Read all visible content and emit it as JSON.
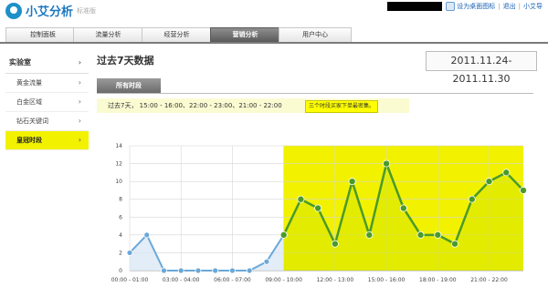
{
  "header": {
    "logo_text": "小艾分析",
    "logo_sub": "标准版",
    "links": [
      "设为桌面图标",
      "退出",
      "小艾导"
    ]
  },
  "nav": {
    "tabs": [
      {
        "label": "控制面板",
        "active": false
      },
      {
        "label": "流量分析",
        "active": false
      },
      {
        "label": "经营分析",
        "active": false
      },
      {
        "label": "营销分析",
        "active": true
      },
      {
        "label": "用户中心",
        "active": false
      }
    ]
  },
  "sidebar": {
    "heading": "实验室",
    "items": [
      {
        "label": "黄金流量",
        "active": false
      },
      {
        "label": "白金区域",
        "active": false
      },
      {
        "label": "钻石关键词",
        "active": false
      },
      {
        "label": "皇冠时段",
        "active": true
      }
    ]
  },
  "main": {
    "title": "过去7天数据",
    "date_range": "2011.11.24-2011.11.30",
    "subtab": "所有时段",
    "note": "过去7天， 15:00 - 16:00、22:00 - 23:00、21:00 - 22:00",
    "tooltip": "三个时段买家下单最密集。"
  },
  "colors": {
    "highlight": "#f2f200",
    "line_blue": "#6aa8d8",
    "line_green": "#4a9a2a"
  },
  "chart_data": {
    "type": "line",
    "ylim": [
      0,
      14
    ],
    "yticks": [
      0,
      2,
      4,
      6,
      8,
      10,
      12,
      14
    ],
    "xtick_labels": [
      "00:00 - 01:00",
      "03:00 - 04:00",
      "06:00 - 07:00",
      "09:00 - 10:00",
      "12:00 - 13:00",
      "15:00 - 16:00",
      "18:00 - 19:00",
      "21:00 - 22:00"
    ],
    "xtick_hours": [
      0,
      3,
      6,
      9,
      12,
      15,
      18,
      21
    ],
    "values": [
      2,
      4,
      0,
      0,
      0,
      0,
      0,
      0,
      1,
      4,
      8,
      7,
      3,
      10,
      4,
      12,
      7,
      4,
      4,
      3,
      8,
      10,
      11,
      9
    ],
    "highlight_from_hour": 9
  }
}
